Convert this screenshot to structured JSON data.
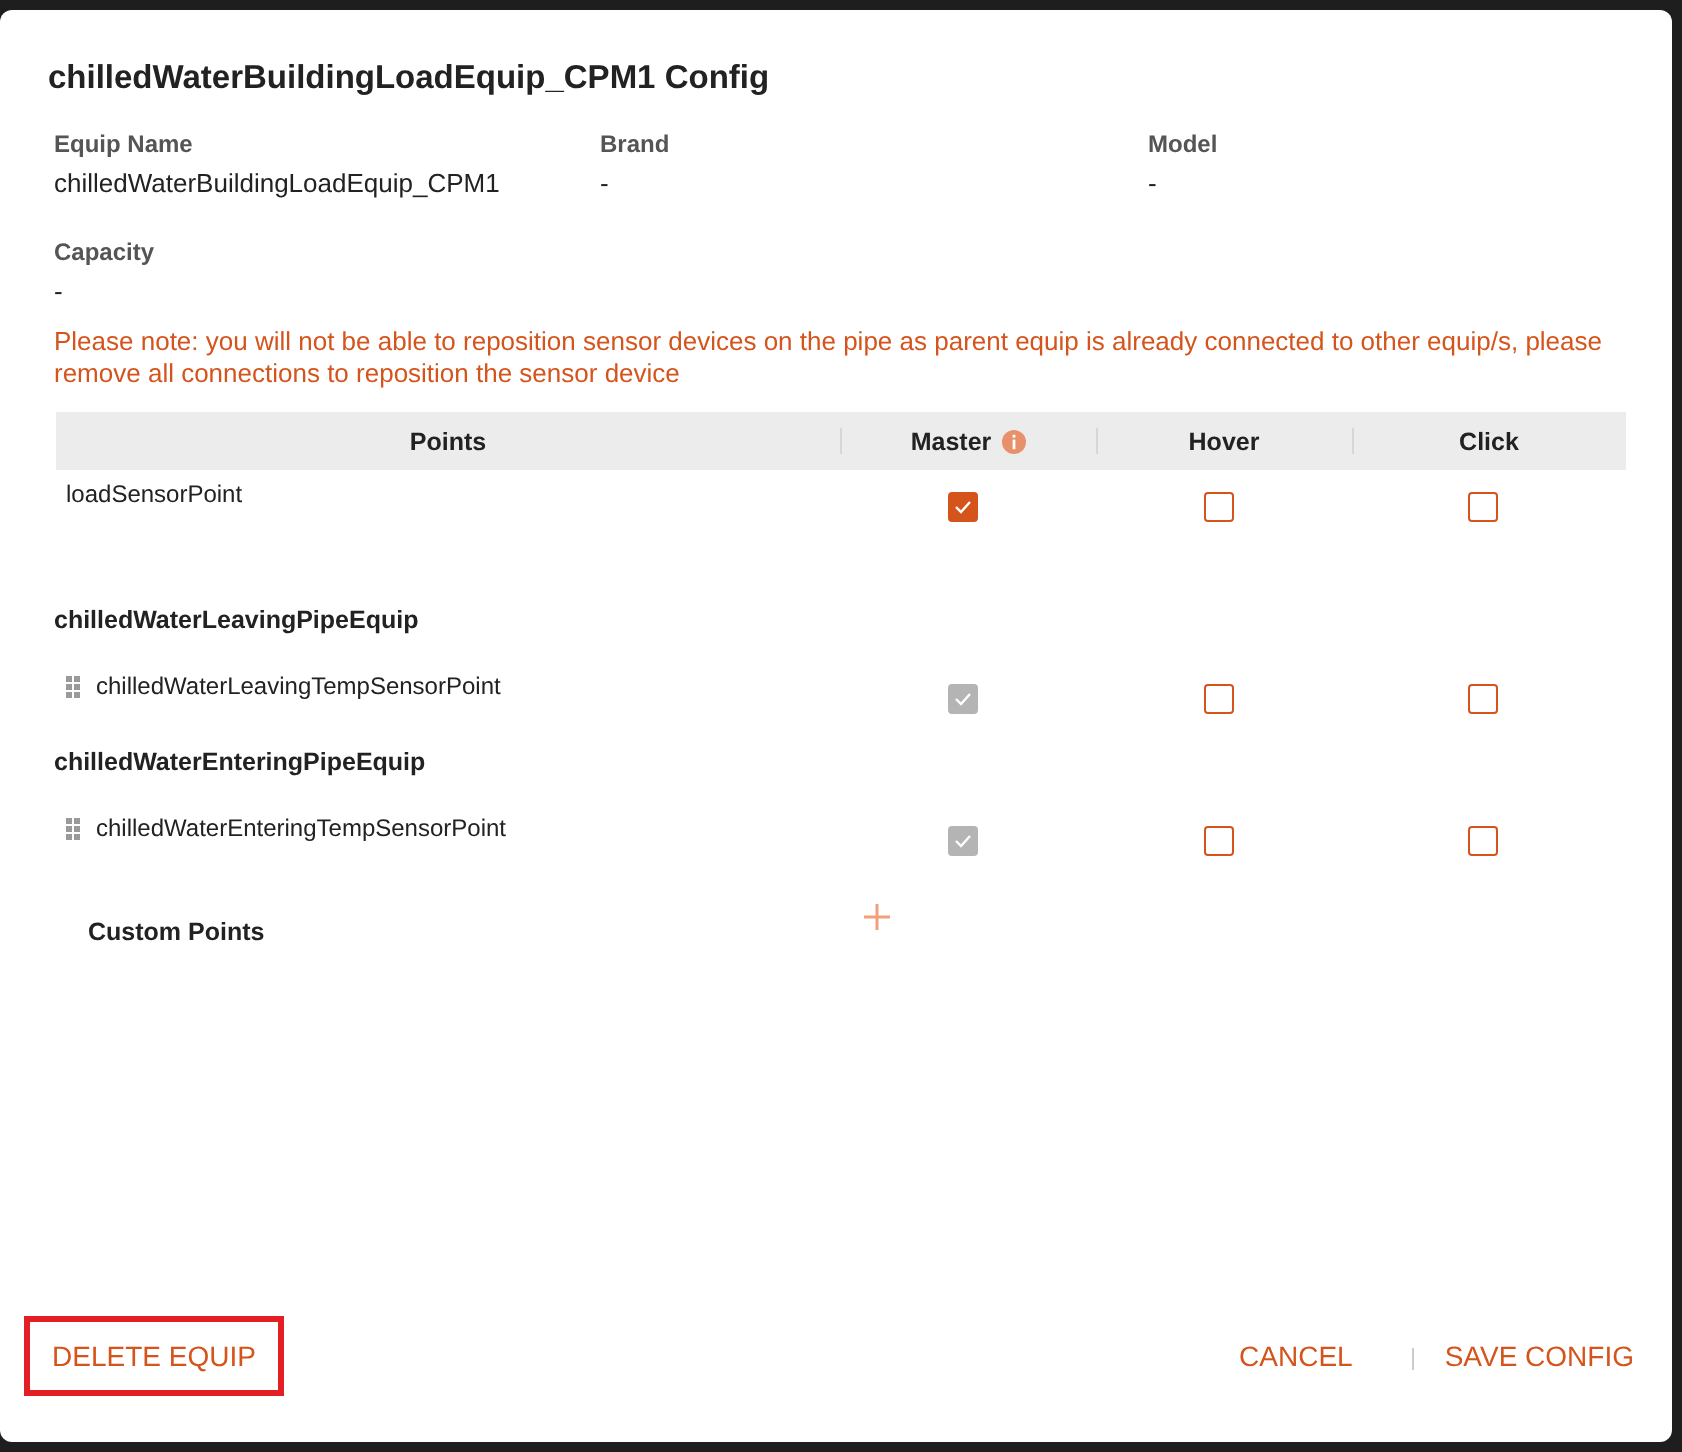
{
  "dialog": {
    "title": "chilledWaterBuildingLoadEquip_CPM1 Config"
  },
  "fields": [
    {
      "label": "Equip Name",
      "value": "chilledWaterBuildingLoadEquip_CPM1"
    },
    {
      "label": "Brand",
      "value": "-"
    },
    {
      "label": "Model",
      "value": "-"
    },
    {
      "label": "Capacity",
      "value": "-"
    }
  ],
  "note": "Please note: you will not be able to reposition sensor devices on the pipe as parent equip is already connected to other equip/s, please remove all connections to reposition the sensor device",
  "table": {
    "columns": [
      {
        "label": "Points",
        "info": false
      },
      {
        "label": "Master",
        "info": true
      },
      {
        "label": "Hover",
        "info": false
      },
      {
        "label": "Click",
        "info": false
      }
    ],
    "sections": [
      {
        "points": [
          {
            "name": "loadSensorPoint",
            "draggable": false,
            "master": {
              "checked": true,
              "disabled": false
            },
            "hover": {
              "checked": false
            },
            "click": {
              "checked": false
            }
          }
        ]
      },
      {
        "title": "chilledWaterLeavingPipeEquip",
        "points": [
          {
            "name": "chilledWaterLeavingTempSensorPoint",
            "draggable": true,
            "master": {
              "checked": true,
              "disabled": true
            },
            "hover": {
              "checked": false
            },
            "click": {
              "checked": false
            }
          }
        ]
      },
      {
        "title": "chilledWaterEnteringPipeEquip",
        "points": [
          {
            "name": "chilledWaterEnteringTempSensorPoint",
            "draggable": true,
            "master": {
              "checked": true,
              "disabled": true
            },
            "hover": {
              "checked": false
            },
            "click": {
              "checked": false
            }
          }
        ]
      }
    ],
    "custom_points": {
      "label": "Custom Points"
    }
  },
  "footer": {
    "delete": {
      "label": "DELETE EQUIP",
      "highlighted": true
    },
    "actions": [
      {
        "label": "CANCEL"
      },
      {
        "label": "SAVE CONFIG"
      }
    ]
  }
}
